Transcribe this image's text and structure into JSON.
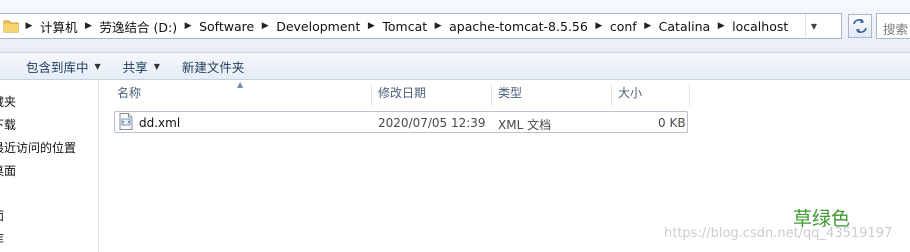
{
  "address_bar": {
    "breadcrumbs": [
      "计算机",
      "劳逸结合 (D:)",
      "Software",
      "Development",
      "Tomcat",
      "apache-tomcat-8.5.56",
      "conf",
      "Catalina",
      "localhost"
    ],
    "search_placeholder": "搜索"
  },
  "toolbar": {
    "include_in_library": "包含到库中",
    "share": "共享",
    "new_folder": "新建文件夹"
  },
  "nav_pane": {
    "items": [
      "藏夹",
      "下载",
      "最近访问的位置",
      "桌面",
      "面",
      "库"
    ]
  },
  "columns": {
    "name": "名称",
    "modified": "修改日期",
    "type": "类型",
    "size": "大小"
  },
  "files": [
    {
      "name": "dd.xml",
      "modified": "2020/07/05 12:39",
      "type": "XML 文档",
      "size": "0 KB"
    }
  ],
  "watermark": {
    "author": "草绿色",
    "url": "https://blog.csdn.net/qq_43519197"
  }
}
